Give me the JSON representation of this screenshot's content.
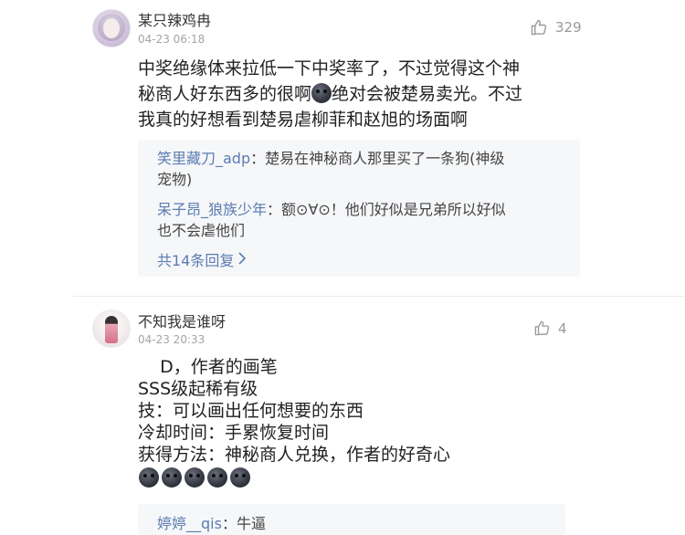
{
  "comments": [
    {
      "username": "某只辣鸡冉",
      "timestamp": "04-23 06:18",
      "likes": "329",
      "avatar_icon": "anime-girl-avatar",
      "content_part1": "中奖绝缘体来拉低一下中奖率了，不过觉得这个神\n秘商人好东西多的很啊",
      "content_part2": "绝对会被楚易卖光。不过\n我真的好想看到楚易虐柳菲和赵旭的场面啊",
      "replies": [
        {
          "name": "笑里藏刀_adp",
          "separator": "：",
          "text": "楚易在神秘商人那里买了一条狗(神级\n宠物)"
        },
        {
          "name": "呆子昂_狼族少年",
          "separator": "：",
          "text": "额⊙∀⊙！他们好似是兄弟所以好似\n也不会虐他们"
        }
      ],
      "more_replies_label": "共14条回复"
    },
    {
      "username": "不知我是谁呀",
      "timestamp": "04-23 20:33",
      "likes": "4",
      "avatar_icon": "anime-figure-avatar",
      "content": "    D，作者的画笔\nSSS级起稀有级\n技：可以画出任何想要的东西\n冷却时间：手累恢复时间\n获得方法：神秘商人兑换，作者的好奇心",
      "emoji_count": 5,
      "replies": [
        {
          "name": "婷婷__qis",
          "separator": "：",
          "text": "牛逼"
        }
      ]
    }
  ],
  "icons": {
    "like": "thumbs-up-icon",
    "chevron": "chevron-right-icon",
    "emoji": "dark-face-emoji"
  },
  "colors": {
    "reply_name": "#5b7cb2",
    "reply_box_bg": "#f6f7f9",
    "muted": "#a4a4a4"
  }
}
